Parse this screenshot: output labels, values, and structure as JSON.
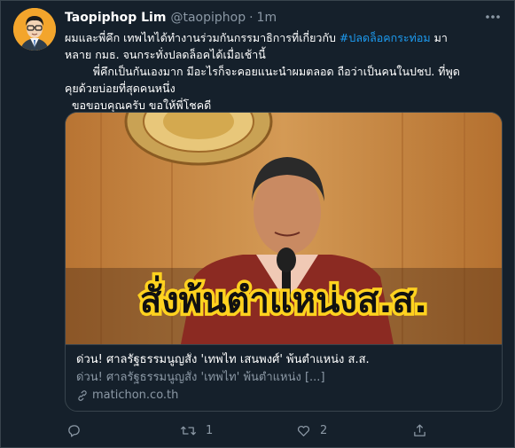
{
  "tweet": {
    "display_name": "Taopiphop Lim",
    "handle": "@taopiphop",
    "separator": "·",
    "time": "1m",
    "text_line1_pre": "ผมและพี่คึก เทพไทได้ทำงานร่วมกันกรรมาธิการที่เกี่ยวกับ ",
    "hashtag": "#ปลดล็อคกระท่อม",
    "text_line1_post": " มา",
    "text_line2": "หลาย กมธ. จนกระทั่งปลดล็อคได้เมื่อเช้านี้",
    "text_line3": "        พี่คึกเป็นกันเองมาก มีอะไรก็จะคอยแนะนำผมตลอด ถือว่าเป็นคนในปชป. ที่พูด",
    "text_line4": "คุยด้วยบ่อยที่สุดคนหนึ่ง",
    "text_line5": "  ขอขอบคุณครับ ขอให้พี่โชคดี"
  },
  "card": {
    "overlay_text": "สั่งพ้นตำแหน่งส.ส.",
    "title": "ด่วน! ศาลรัฐธรรมนูญสั่ง 'เทพไท เสนพงศ์' พ้นตำแหน่ง ส.ส.",
    "description": "ด่วน! ศาลรัฐธรรมนูญสั่ง 'เทพไท' พ้นตำแหน่ง [...]",
    "domain": "matichon.co.th"
  },
  "actions": {
    "reply_count": "",
    "retweet_count": "1",
    "like_count": "2",
    "share_count": ""
  },
  "colors": {
    "background": "#15202b",
    "border": "#38444d",
    "secondary_text": "#8b98a5",
    "hashtag": "#1d9bf0",
    "overlay_text_fill": "#111111",
    "overlay_text_outline": "#ffd21f"
  },
  "icons": [
    "avatar",
    "more-icon",
    "link-icon",
    "reply-icon",
    "retweet-icon",
    "like-icon",
    "share-icon"
  ]
}
